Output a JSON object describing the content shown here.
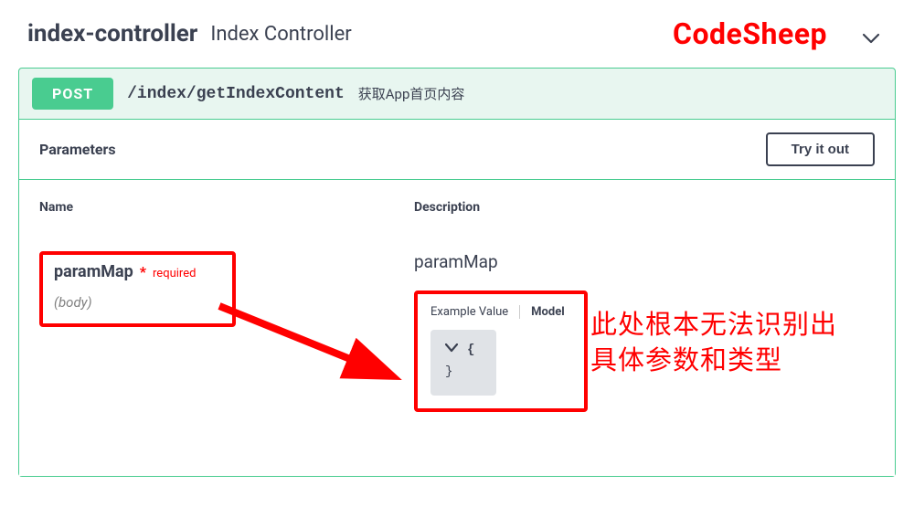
{
  "header": {
    "name": "index-controller",
    "description": "Index Controller"
  },
  "watermark": "CodeSheep",
  "operation": {
    "method": "POST",
    "path": "/index/getIndexContent",
    "summary": "获取App首页内容"
  },
  "parameters": {
    "title": "Parameters",
    "try_button": "Try it out",
    "columns": {
      "name": "Name",
      "description": "Description"
    }
  },
  "param": {
    "name": "paramMap",
    "required_label": "required",
    "in": "(body)",
    "description": "paramMap"
  },
  "tabs": {
    "example": "Example Value",
    "model": "Model"
  },
  "code": {
    "line1": "{",
    "line2": "}"
  },
  "annotation": {
    "line1": "此处根本无法识别出",
    "line2": "具体参数和类型"
  }
}
